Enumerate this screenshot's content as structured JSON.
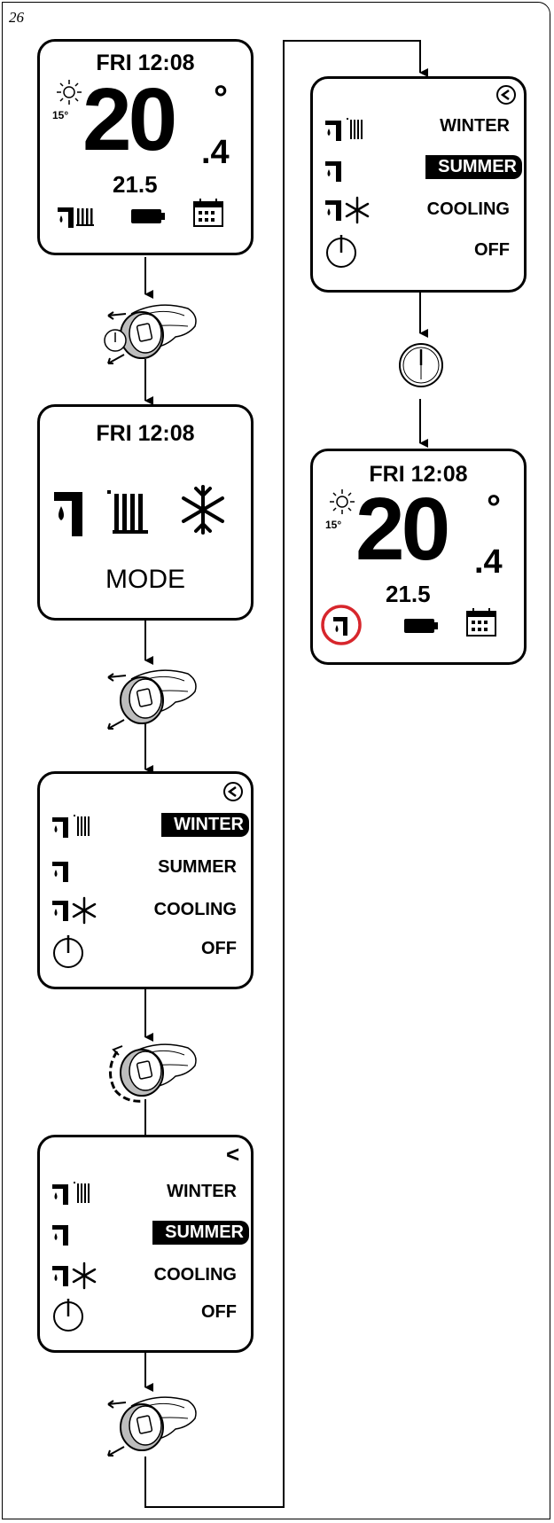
{
  "figure": {
    "number": "26"
  },
  "screens": {
    "home_1": {
      "day_time": "FRI 12:08",
      "outdoor_temp": "15°",
      "temp_main": "20",
      "temp_decimal": ".4",
      "degree": "°",
      "setpoint": "21.5",
      "icons": [
        "tap-radiator-icon",
        "battery-icon",
        "calendar-icon"
      ]
    },
    "mode": {
      "day_time": "FRI 12:08",
      "label": "MODE",
      "icons": [
        "tap-icon",
        "radiator-icon",
        "snowflake-icon"
      ]
    },
    "menu_winter": {
      "back": "<",
      "items": [
        "WINTER",
        "SUMMER",
        "COOLING",
        "OFF"
      ],
      "selected": "WINTER"
    },
    "menu_summer": {
      "back": "<",
      "items": [
        "WINTER",
        "SUMMER",
        "COOLING",
        "OFF"
      ],
      "selected": "SUMMER"
    },
    "menu_summer_2": {
      "back": "<",
      "items": [
        "WINTER",
        "SUMMER",
        "COOLING",
        "OFF"
      ],
      "selected": "SUMMER"
    },
    "home_2": {
      "day_time": "FRI 12:08",
      "outdoor_temp": "15°",
      "temp_main": "20",
      "temp_decimal": ".4",
      "degree": "°",
      "setpoint": "21.5",
      "icons": [
        "tap-icon-highlighted",
        "battery-icon",
        "calendar-icon"
      ],
      "highlight_color": "#d7262c"
    }
  },
  "steps": [
    "press-knob",
    "press-knob",
    "rotate-knob",
    "press-knob",
    "timeout-clock"
  ]
}
